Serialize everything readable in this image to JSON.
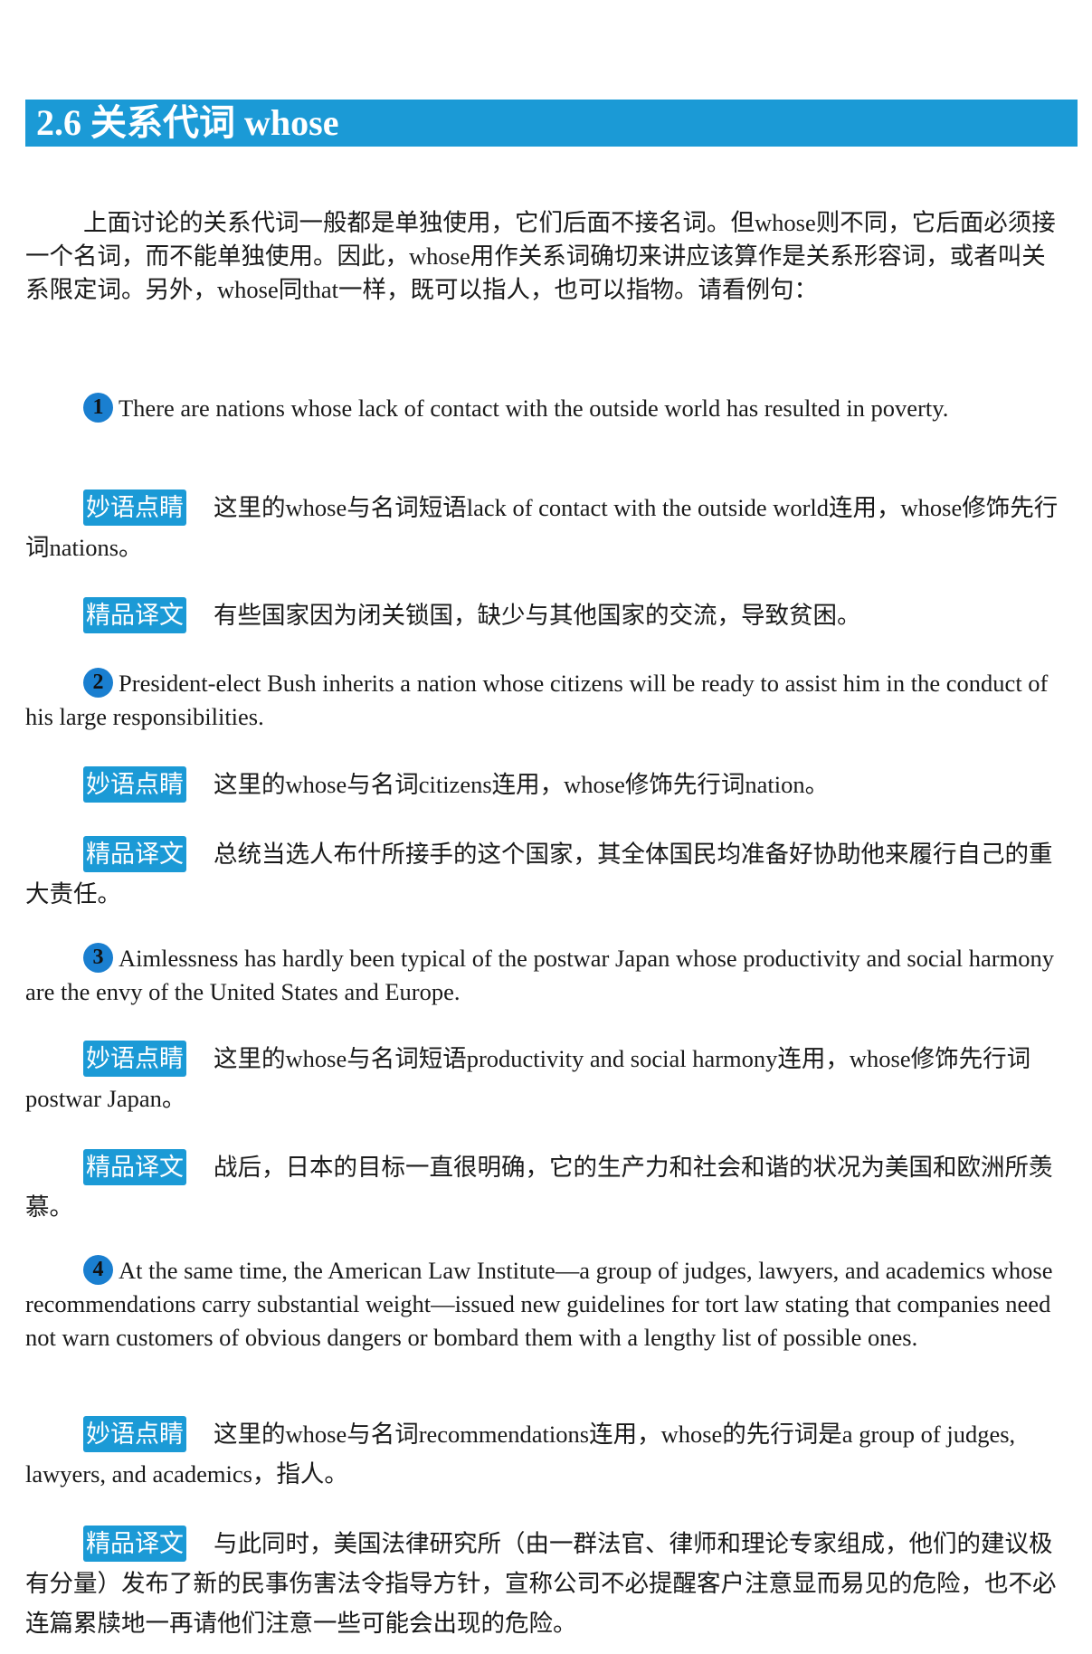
{
  "section": {
    "title": "2.6 关系代词 whose"
  },
  "intro": "上面讨论的关系代词一般都是单独使用，它们后面不接名词。但whose则不同，它后面必须接一个名词，而不能单独使用。因此，whose用作关系词确切来讲应该算作是关系形容词，或者叫关系限定词。另外，whose同that一样，既可以指人，也可以指物。请看例句：",
  "labels": {
    "note": "妙语点睛",
    "translation": "精品译文"
  },
  "examples": [
    {
      "number": "1",
      "sentence": "There are nations whose lack of contact with the outside world has resulted in poverty.",
      "note": "这里的whose与名词短语lack of contact with the outside world连用，whose修饰先行词nations。",
      "translation": "有些国家因为闭关锁国，缺少与其他国家的交流，导致贫困。"
    },
    {
      "number": "2",
      "sentence": "President-elect Bush inherits a nation whose citizens will be ready to assist him in the conduct of his large responsibilities.",
      "note": "这里的whose与名词citizens连用，whose修饰先行词nation。",
      "translation": "总统当选人布什所接手的这个国家，其全体国民均准备好协助他来履行自己的重大责任。"
    },
    {
      "number": "3",
      "sentence": "Aimlessness has hardly been typical of the postwar Japan whose productivity and social harmony are the envy of the United States and Europe.",
      "note": "这里的whose与名词短语productivity and social harmony连用，whose修饰先行词postwar Japan。",
      "translation": "战后，日本的目标一直很明确，它的生产力和社会和谐的状况为美国和欧洲所羡慕。"
    },
    {
      "number": "4",
      "sentence": "At the same time, the American Law Institute—a group of judges, lawyers, and academics whose recommendations carry substantial weight—issued new guidelines for tort law stating that companies need not warn customers of obvious dangers or bombard them with a lengthy list of possible ones.",
      "note": "这里的whose与名词recommendations连用，whose的先行词是a group of judges, lawyers, and academics，指人。",
      "translation": "与此同时，美国法律研究所（由一群法官、律师和理论专家组成，他们的建议极有分量）发布了新的民事伤害法令指导方针，宣称公司不必提醒客户注意显而易见的危险，也不必连篇累牍地一再请他们注意一些可能会出现的危险。"
    }
  ],
  "colors": {
    "accent": "#1b9ad6",
    "badge": "#1a7fd0",
    "text": "#1a1a1a"
  }
}
